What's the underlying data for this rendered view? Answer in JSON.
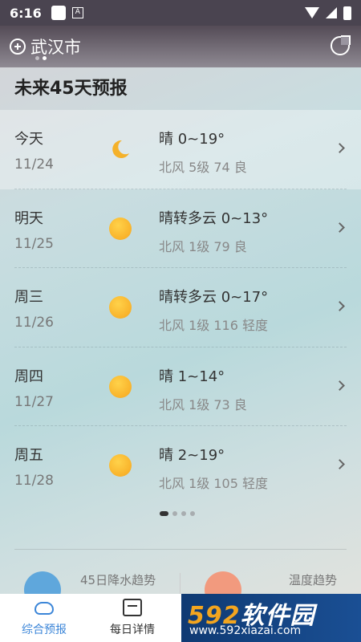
{
  "status": {
    "time": "6:16"
  },
  "header": {
    "city": "武汉市"
  },
  "section_title": "未来45天预报",
  "days": [
    {
      "name": "今天",
      "date": "11/24",
      "icon": "moon-icon",
      "condition": "晴 0~19°",
      "detail": "北风 5级  74 良"
    },
    {
      "name": "明天",
      "date": "11/25",
      "icon": "sun-icon",
      "condition": "晴转多云 0~13°",
      "detail": "北风 1级  79 良"
    },
    {
      "name": "周三",
      "date": "11/26",
      "icon": "sun-icon",
      "condition": "晴转多云 0~17°",
      "detail": "北风 1级  116 轻度"
    },
    {
      "name": "周四",
      "date": "11/27",
      "icon": "sun-icon",
      "condition": "晴 1~14°",
      "detail": "北风 1级  73 良"
    },
    {
      "name": "周五",
      "date": "11/28",
      "icon": "sun-icon",
      "condition": "晴 2~19°",
      "detail": "北风 1级  105 轻度"
    }
  ],
  "trends": {
    "rain": "45日降水趋势",
    "temp": "温度趋势"
  },
  "nav": {
    "home": "综合预报",
    "daily": "每日详情"
  },
  "watermark": {
    "title_num": "592",
    "title_text": "软件园",
    "url": "www.592xiazai.com"
  },
  "colors": {
    "accent": "#3c86d8",
    "sun": "#f6a51d"
  }
}
